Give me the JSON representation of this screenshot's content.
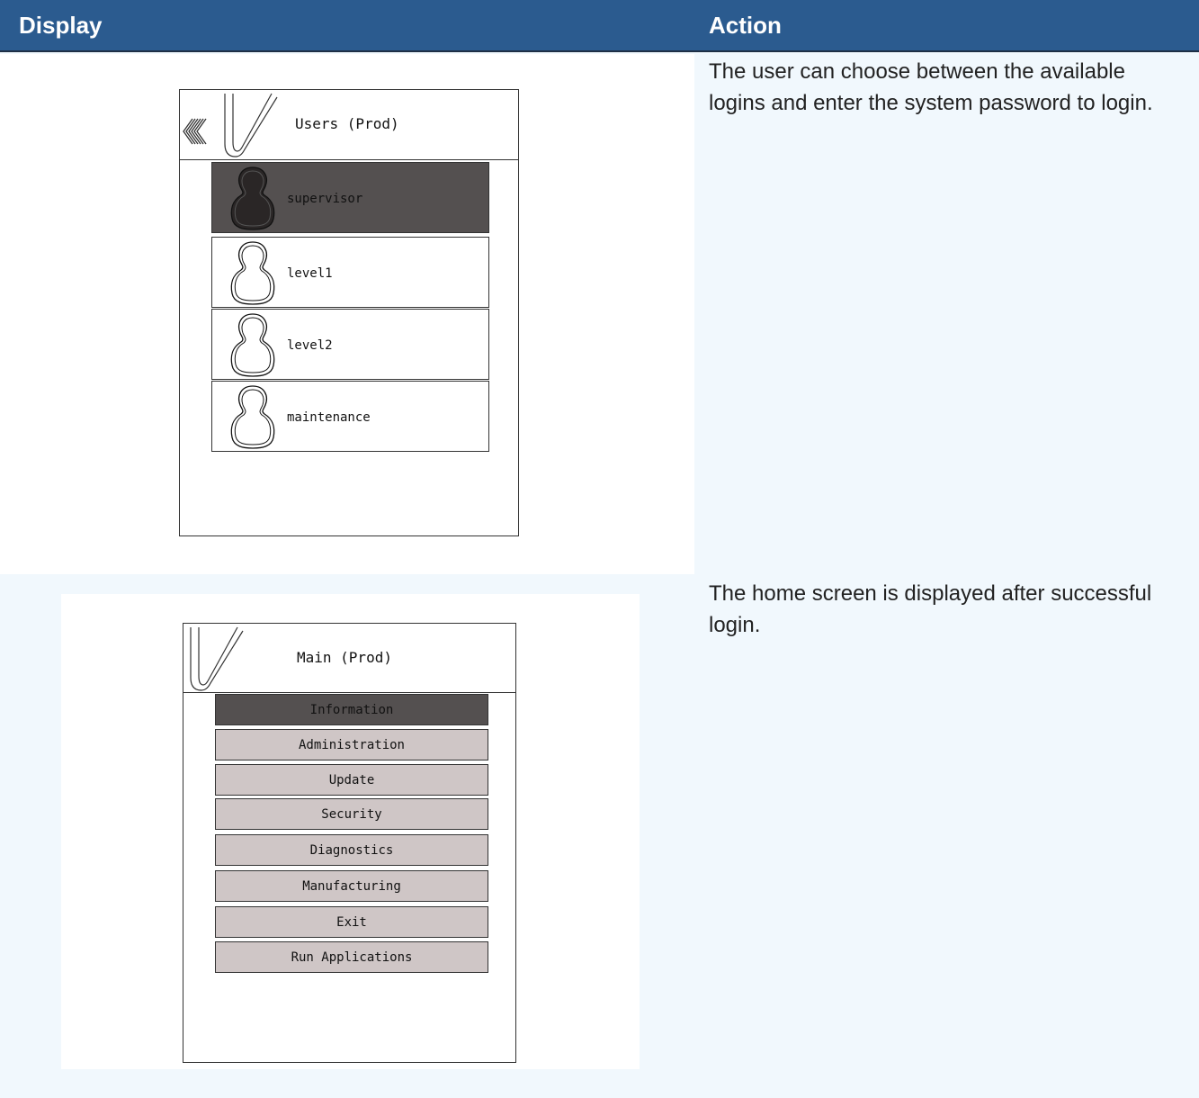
{
  "table": {
    "headers": {
      "display": "Display",
      "action": "Action"
    },
    "rows": [
      {
        "action": "The user can choose between the available logins and enter the system password to login.",
        "screen": {
          "title": "Users (Prod)",
          "users": [
            "supervisor",
            "level1",
            "level2",
            "maintenance"
          ],
          "selected_user": "supervisor"
        }
      },
      {
        "action": "The home screen is displayed after successful login.",
        "screen": {
          "title": "Main (Prod)",
          "menu": [
            "Information",
            "Administration",
            "Update",
            "Security",
            "Diagnostics",
            "Manufacturing",
            "Exit",
            "Run Applications"
          ],
          "active_menu": "Information"
        }
      }
    ]
  },
  "colors": {
    "header_bg": "#2b5b8f",
    "page_bg": "#f1f8fd",
    "selected_item": "#545050",
    "menu_button": "#cfc6c6"
  }
}
